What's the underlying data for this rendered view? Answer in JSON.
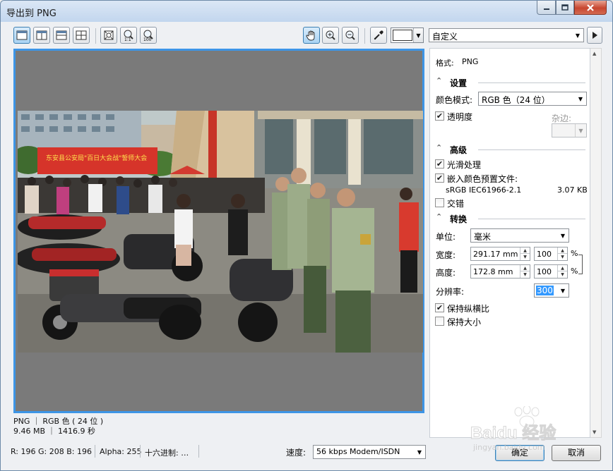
{
  "window": {
    "title": "导出到 PNG"
  },
  "toolbar": {
    "preset": {
      "value": "自定义"
    },
    "color_swatch": "#ffffff"
  },
  "preview": {
    "info_line1": "PNG ｜ RGB 色 ( 24 位 )",
    "info_line2": "9.46 MB ｜ 1416.9 秒"
  },
  "panel": {
    "format_label": "格式:",
    "format_value": "PNG",
    "settings": {
      "header": "设置",
      "color_mode_label": "颜色模式:",
      "color_mode_value": "RGB 色（24 位）",
      "transparency_label": "透明度",
      "transparency_checked": true,
      "matte_label": "杂边:"
    },
    "advanced": {
      "header": "高级",
      "smoothing_label": "光滑处理",
      "smoothing_checked": true,
      "embed_profile_label": "嵌入颜色预置文件:",
      "embed_profile_checked": true,
      "profile_name": "sRGB IEC61966-2.1",
      "profile_size": "3.07 KB",
      "interlace_label": "交错",
      "interlace_checked": false
    },
    "transform": {
      "header": "转换",
      "unit_label": "单位:",
      "unit_value": "毫米",
      "width_label": "宽度:",
      "width_value": "291.17 mm",
      "width_pct": "100",
      "height_label": "高度:",
      "height_value": "172.8 mm",
      "height_pct": "100",
      "pct_symbol": "%",
      "resolution_label": "分辨率:",
      "resolution_value": "300",
      "keep_aspect_label": "保持纵横比",
      "keep_aspect_checked": true,
      "keep_size_label": "保持大小",
      "keep_size_checked": false
    }
  },
  "status": {
    "rgb": "R: 196   G: 208   B: 196",
    "alpha": "Alpha: 255",
    "hex": "十六进制: …",
    "speed_label": "速度:",
    "speed_value": "56 kbps Modem/ISDN"
  },
  "buttons": {
    "ok": "确定",
    "cancel": "取消"
  },
  "photo_sign": "东安县公安局\"百日大会战\"誓师大会",
  "watermark": "Baidu 经验",
  "watermark_sub": "jingyan.baidu.com",
  "colors": {
    "accent_border": "#3d95e6",
    "preview_gray": "#7a7a7a",
    "close_red": "#c7462f"
  }
}
